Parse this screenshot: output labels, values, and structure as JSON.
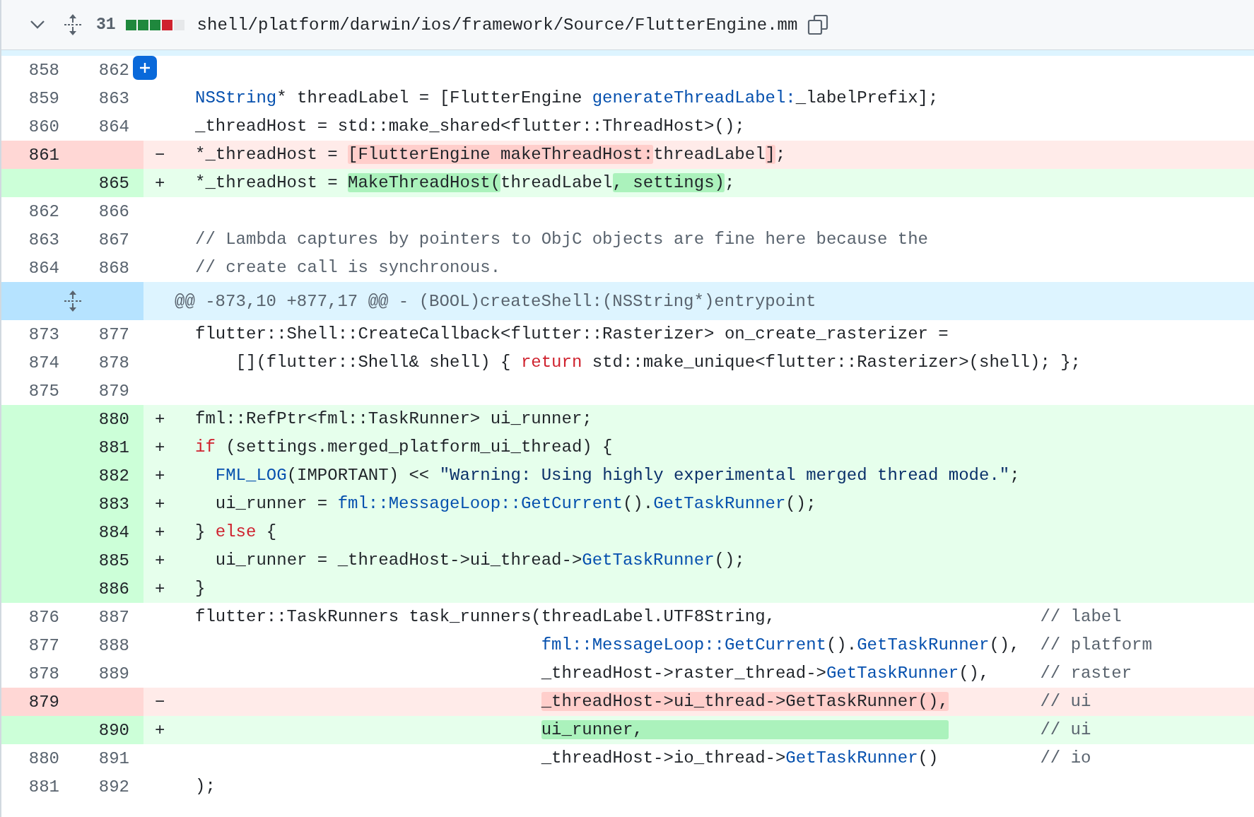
{
  "file_header": {
    "changes": "31",
    "diffstat": [
      {
        "kind": "add"
      },
      {
        "kind": "add"
      },
      {
        "kind": "add"
      },
      {
        "kind": "del"
      },
      {
        "kind": "neutral"
      }
    ],
    "path": "shell/platform/darwin/ios/framework/Source/FlutterEngine.mm"
  },
  "lines": [
    {
      "kind": "context",
      "old": "858",
      "new": "862",
      "comment_button": true
    },
    {
      "kind": "context",
      "old": "859",
      "new": "863",
      "comment_button": false,
      "code": [
        {
          "kind": "function",
          "s": "NSString"
        },
        {
          "kind": "plain",
          "s": "* threadLabel = [FlutterEngine "
        },
        {
          "kind": "function",
          "s": "generateThreadLabel:"
        },
        {
          "kind": "plain",
          "s": "_labelPrefix];"
        }
      ]
    },
    {
      "kind": "context",
      "old": "860",
      "new": "864",
      "comment_button": false,
      "code": [
        {
          "kind": "plain",
          "s": "_threadHost = std::make_shared<flutter::ThreadHost>();"
        }
      ]
    },
    {
      "kind": "del",
      "old": "861",
      "marker": "−",
      "comment_button": false,
      "code": [
        {
          "kind": "plain",
          "s": "*_threadHost = "
        },
        {
          "kind": "mark",
          "s": "[FlutterEngine makeThreadHost:"
        },
        {
          "kind": "plain",
          "s": "threadLabel"
        },
        {
          "kind": "mark",
          "s": "]"
        },
        {
          "kind": "plain",
          "s": ";"
        }
      ]
    },
    {
      "kind": "add",
      "new": "865",
      "marker": "+",
      "comment_button": false,
      "code": [
        {
          "kind": "plain",
          "s": "*_threadHost = "
        },
        {
          "kind": "mark",
          "s": "MakeThreadHost("
        },
        {
          "kind": "plain",
          "s": "threadLabel"
        },
        {
          "kind": "mark",
          "s": ", settings)"
        },
        {
          "kind": "plain",
          "s": ";"
        }
      ]
    },
    {
      "kind": "context",
      "old": "862",
      "new": "866",
      "comment_button": false
    },
    {
      "kind": "context",
      "old": "863",
      "new": "867",
      "comment_button": false,
      "code": [
        {
          "kind": "comment",
          "s": "// Lambda captures by pointers to ObjC objects are fine here because the"
        }
      ]
    },
    {
      "kind": "context",
      "old": "864",
      "new": "868",
      "comment_button": false,
      "code": [
        {
          "kind": "comment",
          "s": "// create call is synchronous."
        }
      ]
    },
    {
      "kind": "hunk",
      "text": "@@ -873,10 +877,17 @@ - (BOOL)createShell:(NSString*)entrypoint"
    },
    {
      "kind": "context",
      "old": "873",
      "new": "877",
      "comment_button": false,
      "code": [
        {
          "kind": "plain",
          "s": "flutter::Shell::CreateCallback<flutter::Rasterizer> on_create_rasterizer ="
        }
      ]
    },
    {
      "kind": "context",
      "old": "874",
      "new": "878",
      "comment_button": false,
      "code": [
        {
          "kind": "plain",
          "s": "    [](flutter::Shell& shell) { "
        },
        {
          "kind": "keyword",
          "s": "return"
        },
        {
          "kind": "plain",
          "s": " std::make_unique<flutter::Rasterizer>(shell); };"
        }
      ]
    },
    {
      "kind": "context",
      "old": "875",
      "new": "879",
      "comment_button": false
    },
    {
      "kind": "add",
      "new": "880",
      "marker": "+",
      "comment_button": false,
      "code": [
        {
          "kind": "plain",
          "s": "fml::RefPtr<fml::TaskRunner> ui_runner;"
        }
      ]
    },
    {
      "kind": "add",
      "new": "881",
      "marker": "+",
      "comment_button": false,
      "code": [
        {
          "kind": "keyword",
          "s": "if"
        },
        {
          "kind": "plain",
          "s": " (settings.merged_platform_ui_thread) {"
        }
      ]
    },
    {
      "kind": "add",
      "new": "882",
      "marker": "+",
      "comment_button": false,
      "code": [
        {
          "kind": "function",
          "s": "  FML_LOG"
        },
        {
          "kind": "plain",
          "s": "(IMPORTANT) << "
        },
        {
          "kind": "string",
          "s": "\"Warning: Using highly experimental merged thread mode.\""
        },
        {
          "kind": "plain",
          "s": ";"
        }
      ]
    },
    {
      "kind": "add",
      "new": "883",
      "marker": "+",
      "comment_button": false,
      "code": [
        {
          "kind": "plain",
          "s": "  ui_runner = "
        },
        {
          "kind": "function",
          "s": "fml::MessageLoop::GetCurrent"
        },
        {
          "kind": "plain",
          "s": "()."
        },
        {
          "kind": "function",
          "s": "GetTaskRunner"
        },
        {
          "kind": "plain",
          "s": "();"
        }
      ]
    },
    {
      "kind": "add",
      "new": "884",
      "marker": "+",
      "comment_button": false,
      "code": [
        {
          "kind": "plain",
          "s": "} "
        },
        {
          "kind": "keyword",
          "s": "else"
        },
        {
          "kind": "plain",
          "s": " {"
        }
      ]
    },
    {
      "kind": "add",
      "new": "885",
      "marker": "+",
      "comment_button": false,
      "code": [
        {
          "kind": "plain",
          "s": "  ui_runner = _threadHost->ui_thread->"
        },
        {
          "kind": "function",
          "s": "GetTaskRunner"
        },
        {
          "kind": "plain",
          "s": "();"
        }
      ]
    },
    {
      "kind": "add",
      "new": "886",
      "marker": "+",
      "comment_button": false,
      "code": [
        {
          "kind": "plain",
          "s": "}"
        }
      ]
    },
    {
      "kind": "context",
      "old": "876",
      "new": "887",
      "comment_button": false,
      "code": [
        {
          "kind": "plain",
          "s": "flutter::TaskRunners task_runners(threadLabel.UTF8String,"
        },
        {
          "kind": "comment",
          "s": "                          // label"
        }
      ]
    },
    {
      "kind": "context",
      "old": "877",
      "new": "888",
      "comment_button": false,
      "code": [
        {
          "kind": "function",
          "s": "                                  fml::MessageLoop::GetCurrent"
        },
        {
          "kind": "plain",
          "s": "()."
        },
        {
          "kind": "function",
          "s": "GetTaskRunner"
        },
        {
          "kind": "plain",
          "s": "(),"
        },
        {
          "kind": "comment",
          "s": "  // platform"
        }
      ]
    },
    {
      "kind": "context",
      "old": "878",
      "new": "889",
      "comment_button": false,
      "code": [
        {
          "kind": "plain",
          "s": "                                  _threadHost->raster_thread->"
        },
        {
          "kind": "function",
          "s": "GetTaskRunner"
        },
        {
          "kind": "plain",
          "s": "(),"
        },
        {
          "kind": "comment",
          "s": "     // raster"
        }
      ]
    },
    {
      "kind": "del",
      "old": "879",
      "marker": "−",
      "comment_button": false,
      "code": [
        {
          "kind": "mark",
          "s": "                                  _threadHost->ui_thread->GetTaskRunner(),"
        },
        {
          "kind": "comment",
          "s": "         // ui"
        }
      ]
    },
    {
      "kind": "add",
      "new": "890",
      "marker": "+",
      "comment_button": false,
      "code": [
        {
          "kind": "mark",
          "s": "                                  ui_runner,                              "
        },
        {
          "kind": "comment",
          "s": "         // ui"
        }
      ]
    },
    {
      "kind": "context",
      "old": "880",
      "new": "891",
      "comment_button": false,
      "code": [
        {
          "kind": "plain",
          "s": "                                  _threadHost->io_thread->"
        },
        {
          "kind": "function",
          "s": "GetTaskRunner"
        },
        {
          "kind": "plain",
          "s": "()"
        },
        {
          "kind": "comment",
          "s": "          // io"
        }
      ]
    },
    {
      "kind": "context",
      "old": "881",
      "new": "892",
      "comment_button": false,
      "code": [
        {
          "kind": "plain",
          "s": ");"
        }
      ]
    }
  ]
}
